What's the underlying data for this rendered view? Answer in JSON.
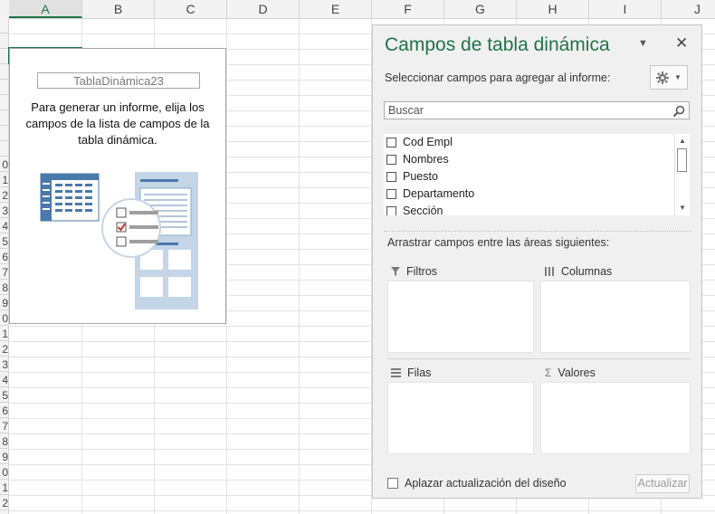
{
  "sheet": {
    "columns": [
      "A",
      "B",
      "C",
      "D",
      "E",
      "F",
      "G",
      "H",
      "I",
      "J"
    ],
    "rows": [
      "",
      "",
      "",
      "",
      "",
      "",
      "",
      "",
      "",
      "0",
      "1",
      "2",
      "3",
      "4",
      "5",
      "6",
      "7",
      "8",
      "9",
      "0",
      "1",
      "2",
      "3",
      "4",
      "5",
      "6",
      "7",
      "8",
      "9",
      "0",
      "1",
      "2"
    ],
    "selected_column": "A"
  },
  "pivot_placeholder": {
    "name": "TablaDinámica23",
    "message": "Para generar un informe, elija los campos de la lista de campos de la tabla dinámica."
  },
  "field_pane": {
    "title": "Campos de tabla dinámica",
    "subtitle": "Seleccionar campos para agregar al informe:",
    "search_placeholder": "Buscar",
    "fields": [
      {
        "label": "Cod Empl",
        "checked": false
      },
      {
        "label": "Nombres",
        "checked": false
      },
      {
        "label": "Puesto",
        "checked": false
      },
      {
        "label": "Departamento",
        "checked": false
      },
      {
        "label": "Sección",
        "checked": false
      }
    ],
    "drag_hint": "Arrastrar campos entre las áreas siguientes:",
    "areas": {
      "filters": "Filtros",
      "columns": "Columnas",
      "rows": "Filas",
      "values": "Valores"
    },
    "defer_label": "Aplazar actualización del diseño",
    "update_label": "Actualizar"
  },
  "colors": {
    "accent": "#217346",
    "illustration_blue": "#4a79ab",
    "illustration_light": "#c5d5e8",
    "check_red": "#c0392b"
  }
}
